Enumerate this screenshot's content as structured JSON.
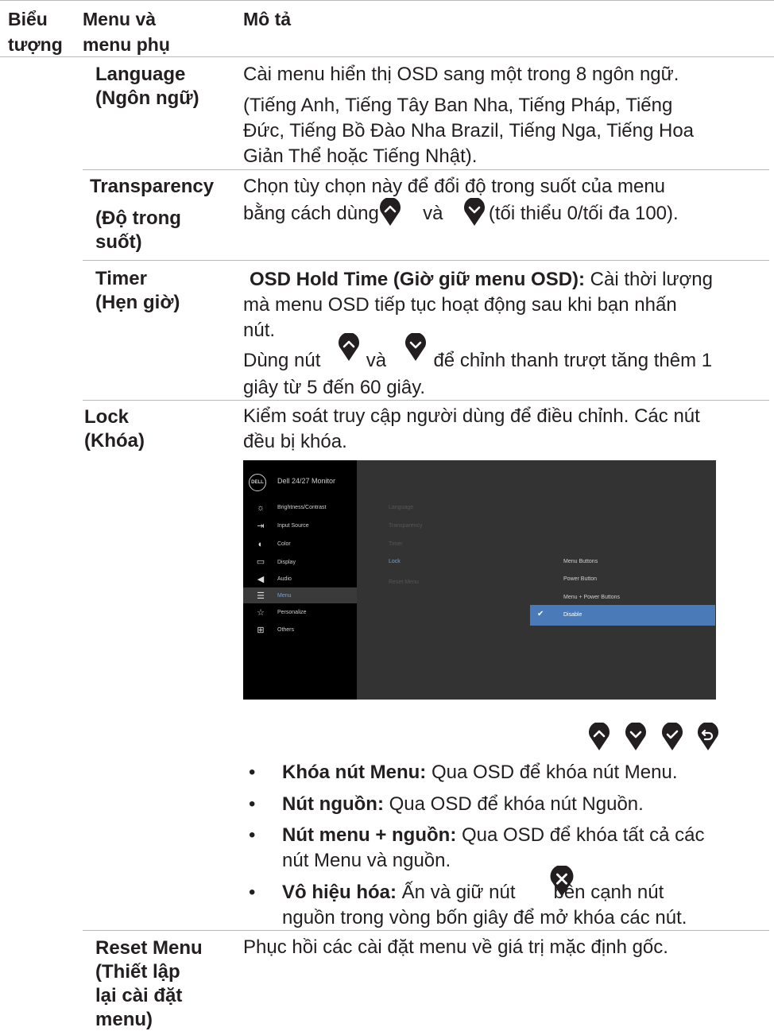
{
  "header": {
    "col_icon": [
      "Biểu",
      "tượng"
    ],
    "col_menu": [
      "Menu và",
      "menu phụ"
    ],
    "col_desc": "Mô tả"
  },
  "rows": {
    "language": {
      "menu": [
        "Language",
        "(Ngôn ngữ)"
      ],
      "desc1": "Cài menu hiển thị OSD sang một trong 8 ngôn ngữ.",
      "desc2": [
        "(Tiếng Anh, Tiếng Tây Ban Nha, Tiếng Pháp, Tiếng",
        "Đức, Tiếng Bồ Đào Nha Brazil, Tiếng Nga, Tiếng Hoa",
        "Giản Thể hoặc Tiếng Nhật)."
      ]
    },
    "transparency": {
      "menu": [
        "Transparency",
        "(Độ trong",
        "suốt)"
      ],
      "desc_line1": "Chọn tùy chọn này để đổi độ trong suốt của menu",
      "desc_pre": "bằng cách dùng",
      "desc_and": "và",
      "desc_post": "(tối thiểu 0/tối đa 100)."
    },
    "timer": {
      "menu": [
        "Timer",
        "(Hẹn giờ)"
      ],
      "desc_bold": "OSD Hold Time (Giờ giữ menu OSD):",
      "desc_rest1": " Cài thời lượng",
      "desc_lines": [
        "mà menu OSD tiếp tục hoạt động sau khi bạn nhấn",
        "nút."
      ],
      "desc2_pre": "Dùng nút",
      "desc2_and": "và",
      "desc2_post": "để chỉnh thanh trượt tăng thêm 1",
      "desc2_line2": "giây từ 5 đến 60 giây."
    },
    "lock": {
      "menu": [
        "Lock",
        "(Khóa)"
      ],
      "desc": [
        "Kiểm soát truy cập người dùng để điều chỉnh. Các nút",
        "đều bị khóa."
      ],
      "bullets": [
        {
          "bold": "Khóa nút Menu:",
          "text": " Qua OSD để khóa nút Menu."
        },
        {
          "bold": "Nút nguồn:",
          "text": " Qua OSD để khóa nút Nguồn."
        },
        {
          "bold": "Nút menu + nguồn:",
          "text": " Qua OSD để khóa tất cả các",
          "line2": "nút Menu và nguồn."
        },
        {
          "bold": "Vô hiệu hóa:",
          "text": " Ấn và giữ nút",
          "text_after": "bên cạnh nút",
          "line2": "nguồn trong vòng bốn giây để mở khóa các nút."
        }
      ]
    },
    "reset": {
      "menu": [
        "Reset Menu",
        "(Thiết lập",
        "lại cài đặt",
        "menu)"
      ],
      "desc": "Phục hồi các cài đặt menu về giá trị mặc định gốc."
    }
  },
  "osd": {
    "logo": "DELL",
    "title": "Dell 24/27 Monitor",
    "side_items": [
      "Brightness/Contrast",
      "Input Source",
      "Color",
      "Display",
      "Audio",
      "Menu",
      "Personalize",
      "Others"
    ],
    "side_icons": [
      "brightness-icon",
      "input-source-icon",
      "color-icon",
      "display-icon",
      "audio-icon",
      "menu-icon",
      "personalize-icon",
      "others-icon"
    ],
    "active_side": "Menu",
    "sub_items": [
      "Language",
      "Transparency",
      "Timer",
      "Lock",
      "Reset Menu"
    ],
    "active_sub": "Lock",
    "options": [
      "Menu Buttons",
      "Power Button",
      "Menu + Power Buttons",
      "Disable"
    ],
    "selected_option": "Disable",
    "accent": "#4a7ab8",
    "highlight": "#6fa3d8"
  },
  "nav_buttons": [
    "up-icon",
    "down-icon",
    "check-icon",
    "back-icon"
  ],
  "colors": {
    "text": "#231f20",
    "rule": "#b9b9b9",
    "nav": "#231f20"
  }
}
